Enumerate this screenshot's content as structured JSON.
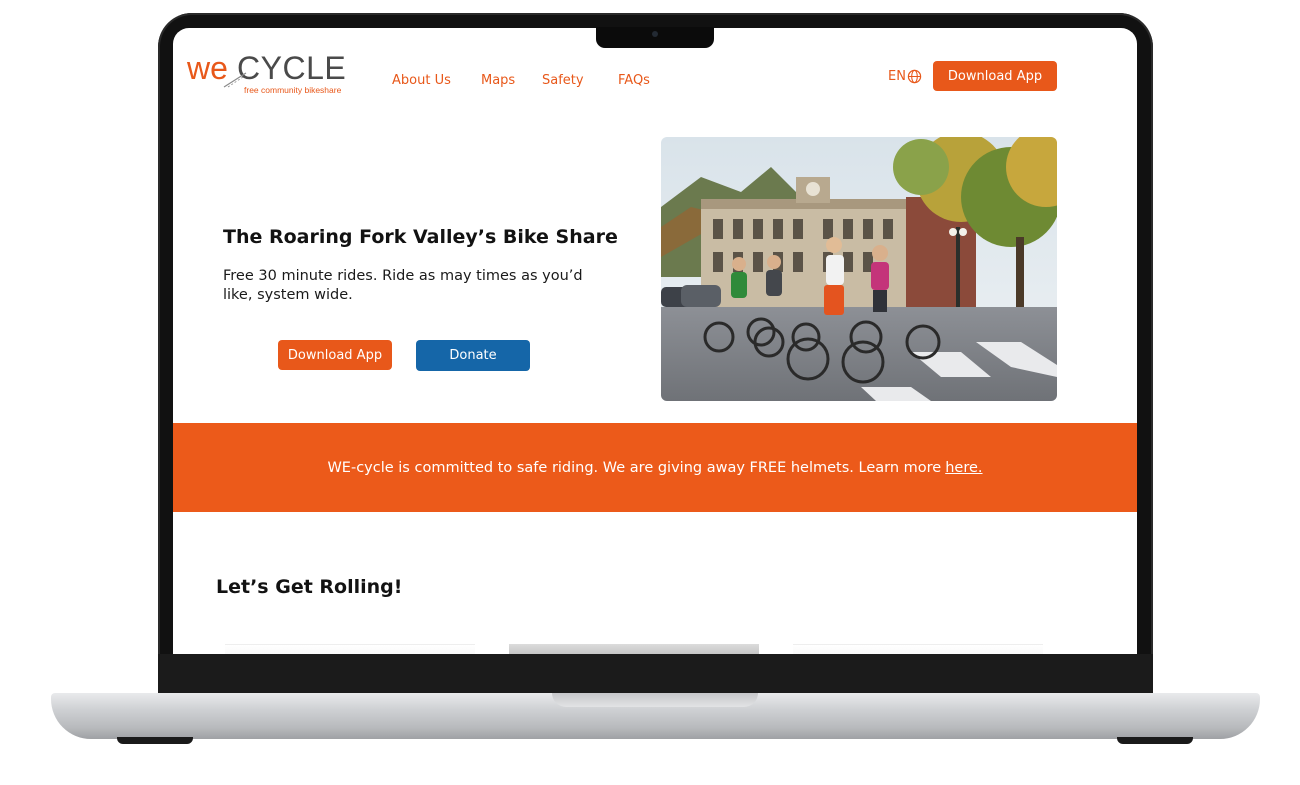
{
  "brand": {
    "logo_we": "WE",
    "logo_cycle": "CYCLE",
    "logo_tagline": "free community bikeshare",
    "accent_color": "#e8581a",
    "secondary_color": "#1566a8"
  },
  "nav": {
    "items": [
      {
        "label": "About Us"
      },
      {
        "label": "Maps"
      },
      {
        "label": "Safety"
      },
      {
        "label": "FAQs"
      }
    ],
    "language": "EN",
    "language_icon": "globe-icon",
    "download_label": "Download App"
  },
  "hero": {
    "title": "The Roaring Fork Valley’s Bike Share",
    "subtitle": "Free 30 minute rides. Ride as may times as you’d like, system wide.",
    "download_label": "Download App",
    "donate_label": "Donate"
  },
  "banner": {
    "text": "WE-cycle is committed to safe riding. We are giving away FREE helmets. Learn more",
    "link_label": "here."
  },
  "section": {
    "title": "Let’s Get Rolling!"
  }
}
